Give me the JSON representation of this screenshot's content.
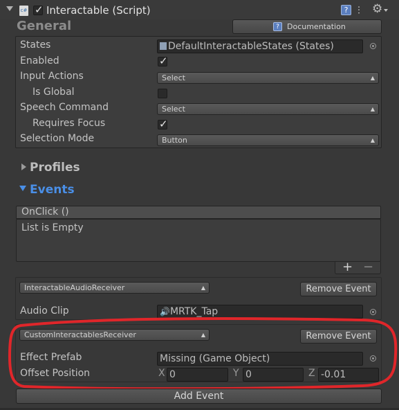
{
  "header": {
    "title": "Interactable (Script)"
  },
  "general": {
    "title": "General",
    "documentation_label": "Documentation",
    "states_label": "States",
    "states_value": "DefaultInteractableStates (States)",
    "enabled_label": "Enabled",
    "input_actions_label": "Input Actions",
    "input_actions_value": "Select",
    "is_global_label": "Is Global",
    "speech_command_label": "Speech Command",
    "speech_command_value": "Select",
    "requires_focus_label": "Requires Focus",
    "selection_mode_label": "Selection Mode",
    "selection_mode_value": "Button"
  },
  "profiles": {
    "title": "Profiles"
  },
  "events": {
    "title": "Events",
    "title_color": "#4a8fe7",
    "onclick_header": "OnClick ()",
    "list_empty": "List is Empty",
    "plus_label": "+",
    "minus_label": "−",
    "receiver1": {
      "type": "InteractableAudioReceiver",
      "remove_label": "Remove Event",
      "audio_clip_label": "Audio Clip",
      "audio_clip_value": "MRTK_Tap"
    },
    "receiver2": {
      "type": "CustomInteractablesReceiver",
      "remove_label": "Remove Event",
      "effect_prefab_label": "Effect Prefab",
      "effect_prefab_value": "Missing (Game Object)",
      "offset_position_label": "Offset Position",
      "x_label": "X",
      "x_value": "0",
      "y_label": "Y",
      "y_value": "0",
      "z_label": "Z",
      "z_value": "-0.01"
    },
    "add_event_label": "Add Event"
  },
  "colors": {
    "background": "#383838",
    "highlight": "#e0262a",
    "accent_blue": "#4a8fe7"
  }
}
